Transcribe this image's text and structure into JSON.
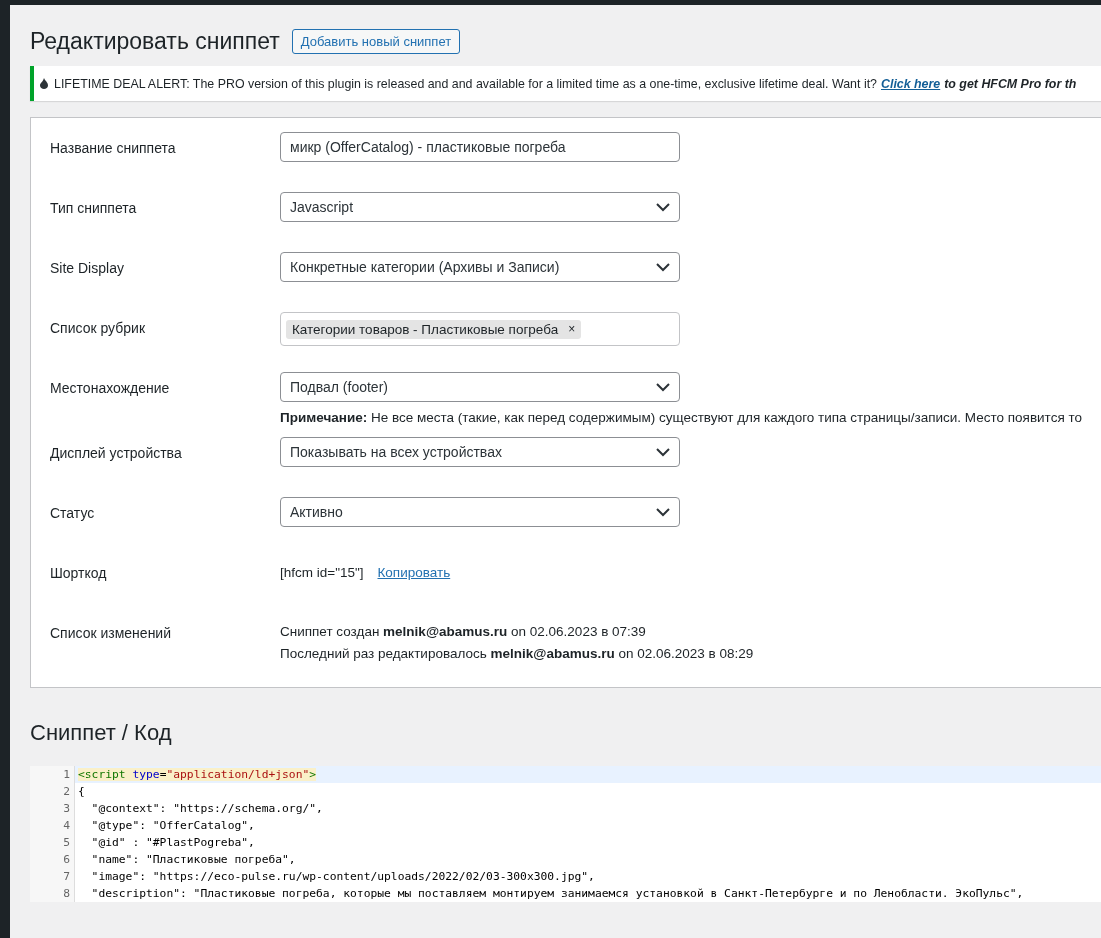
{
  "header": {
    "title": "Редактировать сниппет",
    "add_button": "Добавить новый сниппет"
  },
  "notice": {
    "text": "LIFETIME DEAL ALERT: The PRO version of this plugin is released and and available for a limited time as a one-time, exclusive lifetime deal. Want it?",
    "link": "Click here",
    "after": "to get HFCM Pro for th"
  },
  "form": [
    {
      "kind": "text",
      "label": "Название сниппета",
      "value": "микр (OfferCatalog) - пластиковые погреба"
    },
    {
      "kind": "select",
      "label": "Тип сниппета",
      "value": "Javascript"
    },
    {
      "kind": "select",
      "label": "Site Display",
      "value": "Конкретные категории (Архивы и Записи)"
    },
    {
      "kind": "tags",
      "label": "Список рубрик",
      "tags": [
        "Категории товаров - Пластиковые погреба"
      ],
      "remove": "×"
    },
    {
      "kind": "select",
      "label": "Местонахождение",
      "value": "Подвал (footer)",
      "note": "**Примечание:** Не все места (такие, как перед содержимым) существуют для каждого типа страницы/записи. Место появится то"
    },
    {
      "kind": "select",
      "label": "Дисплей устройства",
      "value": "Показывать на всех устройствах"
    },
    {
      "kind": "select",
      "label": "Статус",
      "value": "Активно"
    },
    {
      "kind": "shortcode",
      "label": "Шорткод",
      "code": "[hfcm id=\"15\"]",
      "link": "Копировать"
    },
    {
      "kind": "changelog",
      "label": "Список изменений",
      "lines": [
        "Сниппет создан **melnik@abamus.ru** on 02.06.2023 в 07:39",
        "Последний раз редактировалось **melnik@abamus.ru** on 02.06.2023 в 08:29"
      ]
    }
  ],
  "code_section": {
    "title": "Сниппет / Код",
    "lines": [
      {
        "number": "1",
        "active": true,
        "tokens": [
          {
            "kind": "tag",
            "text": "<script"
          },
          {
            "kind": "attr",
            "text": " type"
          },
          {
            "kind": "plain",
            "text": "="
          },
          {
            "kind": "string",
            "text": "\"application/ld+json\""
          },
          {
            "kind": "tag",
            "text": ">"
          }
        ]
      },
      {
        "number": "2",
        "active": false,
        "tokens": [
          {
            "kind": "plain",
            "text": "{"
          }
        ]
      },
      {
        "number": "3",
        "active": false,
        "tokens": [
          {
            "kind": "plain",
            "text": "  \"@context\": \"https://schema.org/\","
          }
        ]
      },
      {
        "number": "4",
        "active": false,
        "tokens": [
          {
            "kind": "plain",
            "text": "  \"@type\": \"OfferCatalog\","
          }
        ]
      },
      {
        "number": "5",
        "active": false,
        "tokens": [
          {
            "kind": "plain",
            "text": "  \"@id\" : \"#PlastPogreba\","
          }
        ]
      },
      {
        "number": "6",
        "active": false,
        "tokens": [
          {
            "kind": "plain",
            "text": "  \"name\": \"Пластиковые погреба\","
          }
        ]
      },
      {
        "number": "7",
        "active": false,
        "tokens": [
          {
            "kind": "plain",
            "text": "  \"image\": \"https://eco-pulse.ru/wp-content/uploads/2022/02/03-300x300.jpg\","
          }
        ]
      },
      {
        "number": "8",
        "active": false,
        "tokens": [
          {
            "kind": "plain",
            "text": "  \"description\": \"Пластиковые погреба, которые мы поставляем монтируем занимаемся установкой в Санкт-Петербурге и по Ленобласти. ЭкоПульс\","
          }
        ]
      }
    ]
  }
}
